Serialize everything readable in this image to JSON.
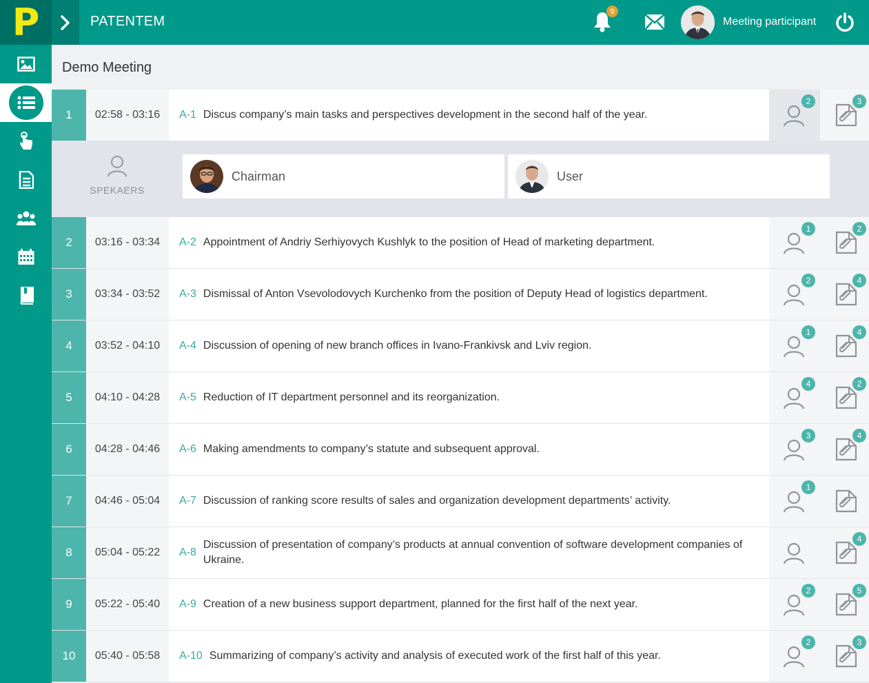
{
  "app": {
    "logo_letter": "P",
    "title": "PATENTEM"
  },
  "header": {
    "notifications_count": "9",
    "user_name": "Meeting participant"
  },
  "meeting": {
    "title": "Demo Meeting"
  },
  "speakers_panel": {
    "label": "SPEKAERS",
    "speakers": [
      {
        "name": "Chairman"
      },
      {
        "name": "User"
      }
    ]
  },
  "agenda": [
    {
      "num": "1",
      "time": "02:58 - 03:16",
      "code": "A-1",
      "text": "Discus company’s main tasks and perspectives development in the second half of the year.",
      "speakers": "2",
      "attachments": "3"
    },
    {
      "num": "2",
      "time": "03:16 - 03:34",
      "code": "A-2",
      "text": "Appointment of Andriy Serhiyovych Kushlyk to the position of Head of marketing department.",
      "speakers": "1",
      "attachments": "2"
    },
    {
      "num": "3",
      "time": "03:34 - 03:52",
      "code": "A-3",
      "text": "Dismissal of Anton Vsevolodovych Kurchenko from the position of Deputy Head of logistics department.",
      "speakers": "2",
      "attachments": "4"
    },
    {
      "num": "4",
      "time": "03:52 - 04:10",
      "code": "A-4",
      "text": "Discussion of opening of new branch offices in Ivano-Frankivsk and Lviv region.",
      "speakers": "1",
      "attachments": "4"
    },
    {
      "num": "5",
      "time": "04:10 - 04:28",
      "code": "A-5",
      "text": "Reduction of IT department personnel and its reorganization.",
      "speakers": "4",
      "attachments": "2"
    },
    {
      "num": "6",
      "time": "04:28 - 04:46",
      "code": "A-6",
      "text": "Making amendments to company’s statute and subsequent approval.",
      "speakers": "3",
      "attachments": "4"
    },
    {
      "num": "7",
      "time": "04:46 - 05:04",
      "code": "A-7",
      "text": "Discussion of ranking score results of sales and organization development departments’ activity.",
      "speakers": "1",
      "attachments": ""
    },
    {
      "num": "8",
      "time": "05:04 - 05:22",
      "code": "A-8",
      "text": "Discussion of presentation of company’s products at annual convention of software development companies of Ukraine.",
      "speakers": "",
      "attachments": "4"
    },
    {
      "num": "9",
      "time": "05:22 - 05:40",
      "code": "A-9",
      "text": "Creation of a new business support department, planned for the first half of the next year.",
      "speakers": "2",
      "attachments": "5"
    },
    {
      "num": "10",
      "time": "05:40 - 05:58",
      "code": "A-10",
      "text": "Summarizing of company’s activity and analysis of executed work of the first half of this year.",
      "speakers": "2",
      "attachments": "3"
    }
  ],
  "icons": {
    "sidebar": [
      "image-icon",
      "list-icon",
      "hand-pointer-icon",
      "document-icon",
      "group-icon",
      "calendar-icon",
      "book-icon"
    ],
    "header": [
      "chevron-right-icon",
      "bell-icon",
      "envelope-icon",
      "power-icon"
    ],
    "row": [
      "person-icon",
      "paperclip-icon"
    ]
  },
  "colors": {
    "primary": "#00998a",
    "logo_bg": "#006f63",
    "logo_letter": "#f2ea13",
    "accent": "#4db5ab",
    "badge_bell": "#d9a437"
  }
}
